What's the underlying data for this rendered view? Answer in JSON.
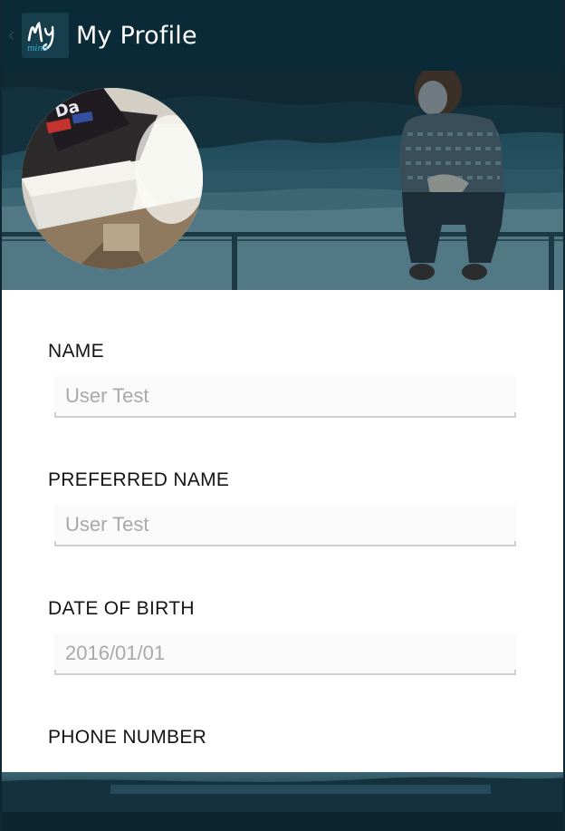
{
  "header": {
    "title": "My Profile",
    "logo_text": "My",
    "logo_subtext": "mind",
    "back_icon": "chevron-left-icon"
  },
  "banner": {
    "avatar_icon": "profile-photo"
  },
  "form": {
    "name": {
      "label": "NAME",
      "value": "User Test"
    },
    "preferred_name": {
      "label": "PREFERRED NAME",
      "value": "User Test"
    },
    "date_of_birth": {
      "label": "DATE OF BIRTH",
      "value": "2016/01/01"
    },
    "phone_number": {
      "label": "PHONE NUMBER"
    }
  },
  "colors": {
    "action_bar": "#0b2a37",
    "accent": "#35b5e5",
    "banner": "#24505f"
  }
}
